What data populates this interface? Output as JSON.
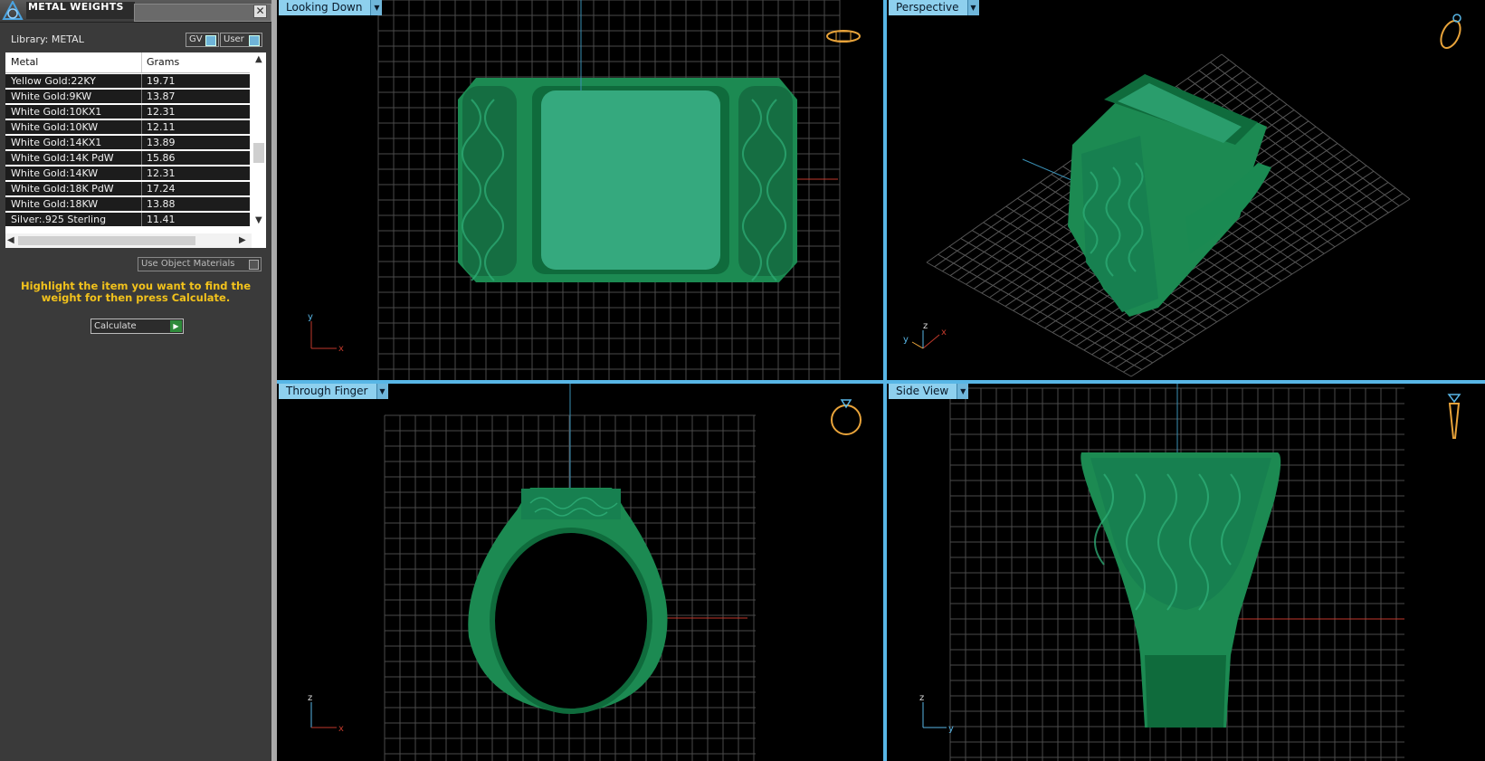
{
  "panel": {
    "title": "METAL WEIGHTS",
    "close_glyph": "✕",
    "library_label": "Library: METAL",
    "toggles": {
      "gv": "GV",
      "user": "User"
    },
    "table": {
      "headers": {
        "metal": "Metal",
        "grams": "Grams"
      },
      "rows": [
        {
          "metal": "Yellow Gold:22KY",
          "grams": "19.71"
        },
        {
          "metal": "White Gold:9KW",
          "grams": "13.87"
        },
        {
          "metal": "White Gold:10KX1",
          "grams": "12.31"
        },
        {
          "metal": "White Gold:10KW",
          "grams": "12.11"
        },
        {
          "metal": "White Gold:14KX1",
          "grams": "13.89"
        },
        {
          "metal": "White Gold:14K PdW",
          "grams": "15.86"
        },
        {
          "metal": "White Gold:14KW",
          "grams": "12.31"
        },
        {
          "metal": "White Gold:18K PdW",
          "grams": "17.24"
        },
        {
          "metal": "White Gold:18KW",
          "grams": "13.88"
        },
        {
          "metal": "Silver:.925 Sterling",
          "grams": "11.41"
        }
      ]
    },
    "use_object_materials": "Use Object Materials",
    "hint": "Highlight the item you want to find the weight for then press Calculate.",
    "calculate_label": "Calculate"
  },
  "viewports": {
    "top": {
      "label": "Looking Down",
      "axes": {
        "v": "y",
        "h": "x"
      },
      "view_icon": "ring-top-icon"
    },
    "persp": {
      "label": "Perspective",
      "axes": {
        "a": "y",
        "b": "z",
        "c": "x"
      },
      "view_icon": "ring-perspective-icon"
    },
    "front": {
      "label": "Through Finger",
      "axes": {
        "v": "z",
        "h": "x"
      },
      "view_icon": "ring-front-icon"
    },
    "side": {
      "label": "Side View",
      "axes": {
        "v": "z",
        "h": "y"
      },
      "view_icon": "ring-side-icon"
    }
  },
  "colors": {
    "ring": "#1e9a5c",
    "ring_dark": "#0f6b3c",
    "ring_light": "#3fb888",
    "grid": "#4a4a4a",
    "accent": "#8ed0ee",
    "hint": "#f2c21c"
  }
}
